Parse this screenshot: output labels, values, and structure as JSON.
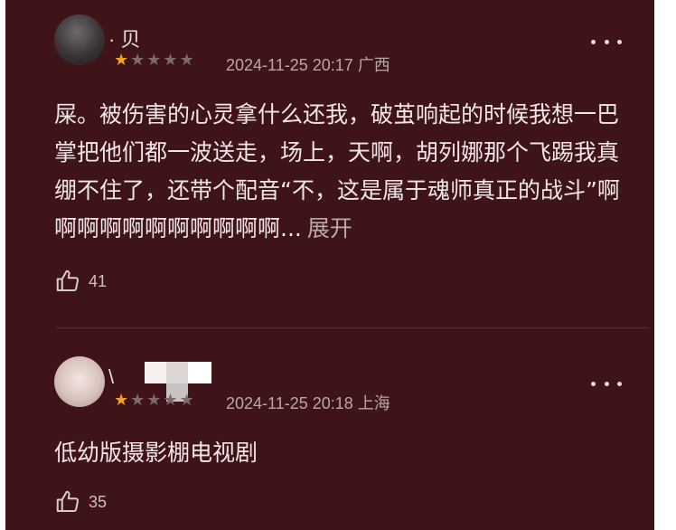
{
  "comments": [
    {
      "username": "· 贝",
      "rating_value": 1,
      "rating_max": 5,
      "date": "2024-11-25 20:17",
      "location": "广西",
      "text": "屎。被伤害的心灵拿什么还我，破茧响起的时候我想一巴掌把他们都一波送走，场上，天啊，胡列娜那个飞踢我真绷不住了，还带个配音“不，这是属于魂师真正的战斗”啊啊啊啊啊啊啊啊啊啊啊...",
      "expand_label": "展开",
      "likes": "41"
    },
    {
      "username": "\\",
      "rating_value": 1,
      "rating_max": 5,
      "date": "2024-11-25 20:18",
      "location": "上海",
      "text": "低幼版摄影棚电视剧",
      "expand_label": "",
      "likes": "35"
    }
  ],
  "icons": {
    "more": "more-dots-icon",
    "like": "thumbs-up-icon",
    "star_on_color": "#f2a21a",
    "star_off_color": "#7c6a6c"
  }
}
